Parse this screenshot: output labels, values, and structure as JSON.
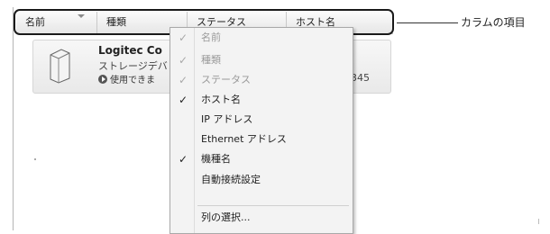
{
  "header": {
    "columns": [
      {
        "label": "名前"
      },
      {
        "label": "種類"
      },
      {
        "label": "ステータス"
      },
      {
        "label": "ホスト名"
      }
    ]
  },
  "device": {
    "name": "Logitec Co",
    "type": "ストレージデバ",
    "status": "使用できま",
    "host_suffix": "345"
  },
  "callout": {
    "label": "カラムの項目"
  },
  "menu": {
    "items": [
      {
        "label": "名前",
        "checked": true,
        "disabled": true
      },
      {
        "label": "種類",
        "checked": true,
        "disabled": true
      },
      {
        "label": "ステータス",
        "checked": true,
        "disabled": true
      },
      {
        "label": "ホスト名",
        "checked": true,
        "disabled": false
      },
      {
        "label": "IP アドレス",
        "checked": false,
        "disabled": false
      },
      {
        "label": "Ethernet アドレス",
        "checked": false,
        "disabled": false
      },
      {
        "label": "機種名",
        "checked": true,
        "disabled": false
      },
      {
        "label": "自動接続設定",
        "checked": false,
        "disabled": false
      },
      {
        "label": "列の選択...",
        "checked": false,
        "disabled": false
      }
    ],
    "check_glyph": "✓"
  }
}
